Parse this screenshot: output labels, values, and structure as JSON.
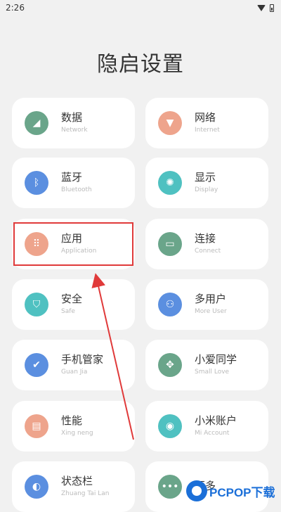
{
  "status_bar": {
    "time": "2:26"
  },
  "title": "隐启设置",
  "cards": [
    {
      "label": "数据",
      "sub": "Network",
      "icon": "signal-icon",
      "color": "#6aa58a",
      "glyph": "◢"
    },
    {
      "label": "网络",
      "sub": "Internet",
      "icon": "wifi-icon",
      "color": "#eea48c",
      "glyph": "▼"
    },
    {
      "label": "蓝牙",
      "sub": "Bluetooth",
      "icon": "bluetooth-icon",
      "color": "#5b8fe0",
      "glyph": "ᛒ"
    },
    {
      "label": "显示",
      "sub": "Display",
      "icon": "brightness-icon",
      "color": "#4fc1c1",
      "glyph": "✺"
    },
    {
      "label": "应用",
      "sub": "Application",
      "icon": "apps-grid-icon",
      "color": "#eea48c",
      "glyph": "⠿"
    },
    {
      "label": "连接",
      "sub": "Connect",
      "icon": "cast-icon",
      "color": "#6aa58a",
      "glyph": "▭"
    },
    {
      "label": "安全",
      "sub": "Safe",
      "icon": "shield-icon",
      "color": "#4fc1c1",
      "glyph": "⛉"
    },
    {
      "label": "多用户",
      "sub": "More User",
      "icon": "users-icon",
      "color": "#5b8fe0",
      "glyph": "⚇"
    },
    {
      "label": "手机管家",
      "sub": "Guan Jia",
      "icon": "shield-check-icon",
      "color": "#5b8fe0",
      "glyph": "✔"
    },
    {
      "label": "小爱同学",
      "sub": "Small Love",
      "icon": "gamepad-icon",
      "color": "#6aa58a",
      "glyph": "✥"
    },
    {
      "label": "性能",
      "sub": "Xing neng",
      "icon": "document-icon",
      "color": "#eea48c",
      "glyph": "▤"
    },
    {
      "label": "小米账户",
      "sub": "Mi Account",
      "icon": "account-icon",
      "color": "#4fc1c1",
      "glyph": "◉"
    },
    {
      "label": "状态栏",
      "sub": "Zhuang Tai Lan",
      "icon": "status-bar-icon",
      "color": "#5b8fe0",
      "glyph": "◐"
    },
    {
      "label": "更多",
      "sub": "",
      "icon": "more-dots-icon",
      "color": "#6aa58a",
      "glyph": "•••"
    }
  ],
  "watermark": {
    "text": "PCPOP下载"
  }
}
